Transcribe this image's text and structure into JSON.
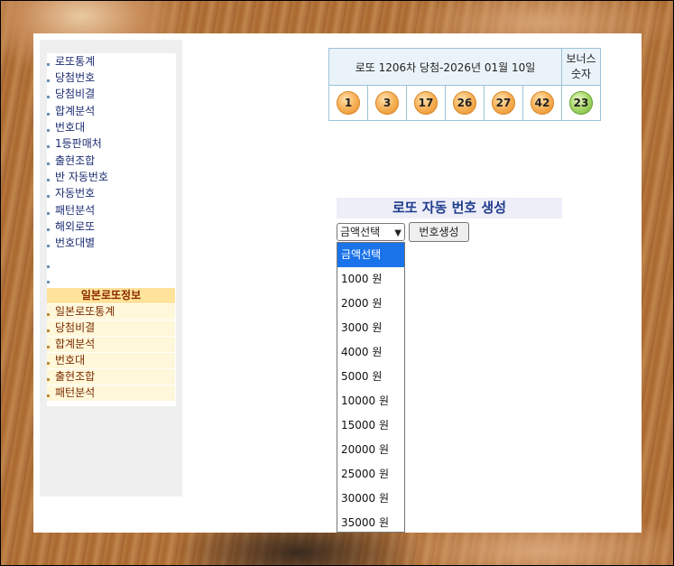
{
  "sidebar": {
    "items": [
      "로또통계",
      "당첨번호",
      "당첨비결",
      "합계분석",
      "번호대",
      "1등판매처",
      "출현조합",
      "반 자동번호",
      "자동번호",
      "패턴분석",
      "해외로또",
      "번호대별",
      "",
      ""
    ],
    "japan_header": "일본로또정보",
    "japan_items": [
      "일본로또통계",
      "당첨비결",
      "합계분석",
      "번호대",
      "출현조합",
      "패턴분석"
    ]
  },
  "draw": {
    "title": "로또 1206차 당첨-2026년 01월 10일",
    "bonus_label_1": "보너스",
    "bonus_label_2": "숫자",
    "numbers": [
      "1",
      "3",
      "17",
      "26",
      "27",
      "42"
    ],
    "bonus": "23"
  },
  "generator": {
    "title": "로또 자동 번호 생성",
    "select_value": "금액선택",
    "button_label": "번호생성",
    "options": [
      "금액선택",
      "1000 원",
      "2000 원",
      "3000 원",
      "4000 원",
      "5000 원",
      "10000 원",
      "15000 원",
      "20000 원",
      "25000 원",
      "30000 원",
      "35000 원"
    ]
  },
  "colors": {
    "ball": "#f7b25a",
    "bonus_ball": "#a9d86a",
    "selected_option": "#1a73e8"
  }
}
